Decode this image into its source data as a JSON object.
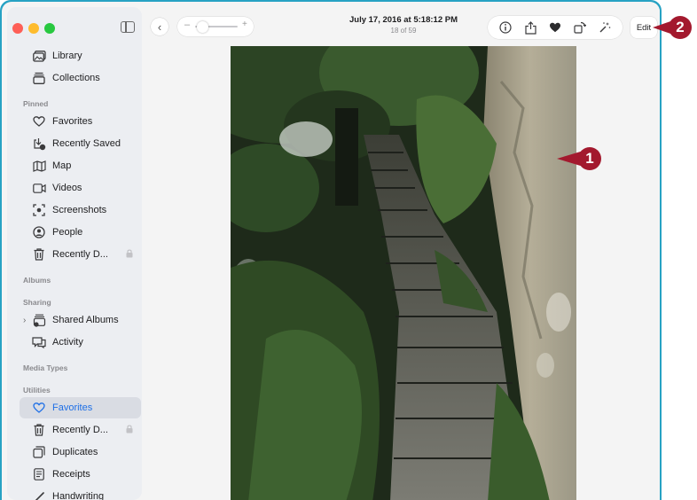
{
  "window": {
    "traffic_colors": [
      "#fe5f57",
      "#febc2e",
      "#28c840"
    ]
  },
  "sidebar": {
    "top_items": [
      {
        "label": "Library",
        "icon": "library-icon"
      },
      {
        "label": "Collections",
        "icon": "collections-icon"
      }
    ],
    "pinned": {
      "header": "Pinned",
      "items": [
        {
          "label": "Favorites",
          "icon": "heart-icon"
        },
        {
          "label": "Recently Saved",
          "icon": "recently-saved-icon"
        },
        {
          "label": "Map",
          "icon": "map-icon"
        },
        {
          "label": "Videos",
          "icon": "video-icon"
        },
        {
          "label": "Screenshots",
          "icon": "screenshot-icon"
        },
        {
          "label": "People",
          "icon": "person-icon"
        },
        {
          "label": "Recently D...",
          "icon": "trash-icon",
          "locked": true
        }
      ]
    },
    "albums_header": "Albums",
    "sharing": {
      "header": "Sharing",
      "items": [
        {
          "label": "Shared Albums",
          "icon": "shared-albums-icon"
        },
        {
          "label": "Activity",
          "icon": "activity-icon"
        }
      ]
    },
    "media_types_header": "Media Types",
    "utilities": {
      "header": "Utilities",
      "items": [
        {
          "label": "Favorites",
          "icon": "heart-icon",
          "selected": true
        },
        {
          "label": "Recently D...",
          "icon": "trash-icon",
          "locked": true
        },
        {
          "label": "Duplicates",
          "icon": "duplicates-icon"
        },
        {
          "label": "Receipts",
          "icon": "receipt-icon"
        },
        {
          "label": "Handwriting",
          "icon": "handwriting-icon"
        }
      ]
    }
  },
  "toolbar": {
    "title": "July 17, 2016 at 5:18:12 PM",
    "subtitle": "18 of 59",
    "zoom_minus": "–",
    "zoom_plus": "+",
    "zoom_level": 0.1,
    "edit_label": "Edit"
  },
  "callouts": [
    {
      "number": "1"
    },
    {
      "number": "2"
    }
  ],
  "colors": {
    "accent": "#1e6fe6",
    "callout": "#a3192e",
    "frame": "#27a2c3"
  }
}
